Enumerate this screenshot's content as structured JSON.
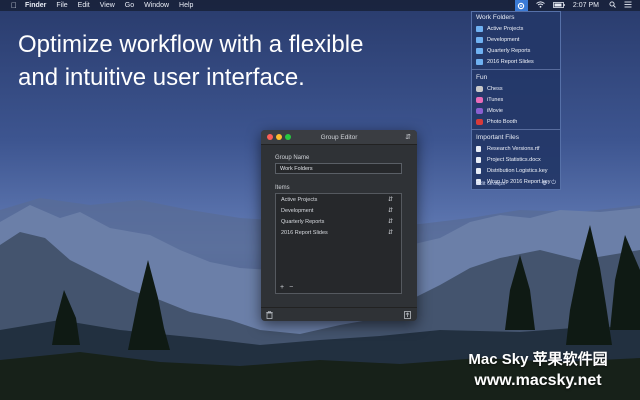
{
  "menubar": {
    "app_name": "Finder",
    "items": [
      "File",
      "Edit",
      "View",
      "Go",
      "Window",
      "Help"
    ],
    "clock": "2:07 PM"
  },
  "headline": {
    "line1": "Optimize workflow with a flexible",
    "line2": "and intuitive user interface."
  },
  "dropdown": {
    "sections": [
      {
        "header": "Work Folders",
        "entries": [
          {
            "label": "Active Projects",
            "icon": "folder-icon"
          },
          {
            "label": "Development",
            "icon": "folder-icon"
          },
          {
            "label": "Quarterly Reports",
            "icon": "folder-icon"
          },
          {
            "label": "2016 Report Slides",
            "icon": "folder-icon"
          }
        ]
      },
      {
        "header": "Fun",
        "entries": [
          {
            "label": "Chess",
            "icon": "chess-app-icon"
          },
          {
            "label": "iTunes",
            "icon": "itunes-app-icon"
          },
          {
            "label": "iMovie",
            "icon": "imovie-app-icon"
          },
          {
            "label": "Photo Booth",
            "icon": "photobooth-app-icon"
          }
        ]
      },
      {
        "header": "Important Files",
        "entries": [
          {
            "label": "Research Versions.rtf",
            "icon": "document-icon"
          },
          {
            "label": "Project Statistics.docx",
            "icon": "document-icon"
          },
          {
            "label": "Distribution Logistics.key",
            "icon": "document-icon"
          },
          {
            "label": "Wrap Up 2016 Report.key",
            "icon": "document-icon"
          }
        ]
      }
    ],
    "footer_label": "Edit Groups"
  },
  "editor": {
    "title": "Group Editor",
    "group_name_label": "Group Name",
    "group_name_value": "Work Folders",
    "items_label": "Items",
    "items": [
      "Active Projects",
      "Development",
      "Quarterly Reports",
      "2016 Report Slides"
    ]
  },
  "watermark": {
    "line1": "Mac Sky 苹果软件园",
    "line2": "www.macsky.net"
  },
  "colors": {
    "accent": "#3b7bd6",
    "menu_bg": "#243868",
    "window_bg": "#2f3236"
  }
}
